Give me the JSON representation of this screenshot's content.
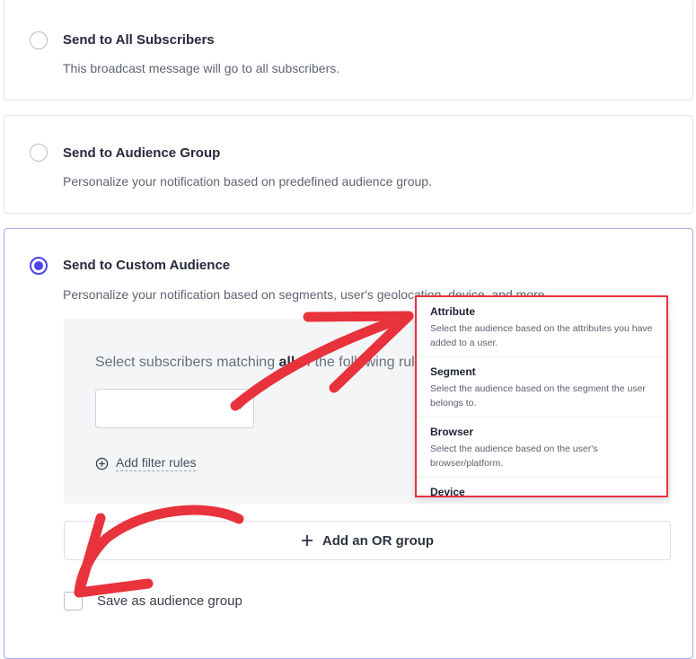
{
  "options": [
    {
      "title": "Send to All Subscribers",
      "description": "This broadcast message will go to all subscribers.",
      "selected": false
    },
    {
      "title": "Send to Audience Group",
      "description": "Personalize your notification based on predefined audience group.",
      "selected": false
    },
    {
      "title": "Send to Custom Audience",
      "description": "Personalize your notification based on segments, user's geolocation, device, and more.",
      "selected": true
    }
  ],
  "filter": {
    "match_prefix": "Select subscribers matching ",
    "match_bold": "all",
    "match_suffix": " of the following rules:",
    "select_value": "",
    "add_filter_label": "Add filter rules"
  },
  "or_group_label": "Add an OR group",
  "save_group": {
    "label": "Save as audience group",
    "checked": false
  },
  "dropdown": {
    "items": [
      {
        "title": "Attribute",
        "description": "Select the audience based on the attributes you have added to a user."
      },
      {
        "title": "Segment",
        "description": "Select the audience based on the segment the user belongs to."
      },
      {
        "title": "Browser",
        "description": "Select the audience based on the user's browser/platform."
      },
      {
        "title": "Device",
        "description": ""
      }
    ]
  },
  "colors": {
    "accent": "#4a44ea",
    "annotation": "#e8323c"
  },
  "icons": {
    "add_filter": "plus-circle-icon",
    "or_group": "plus-icon",
    "select": "chevron-down-icon"
  }
}
